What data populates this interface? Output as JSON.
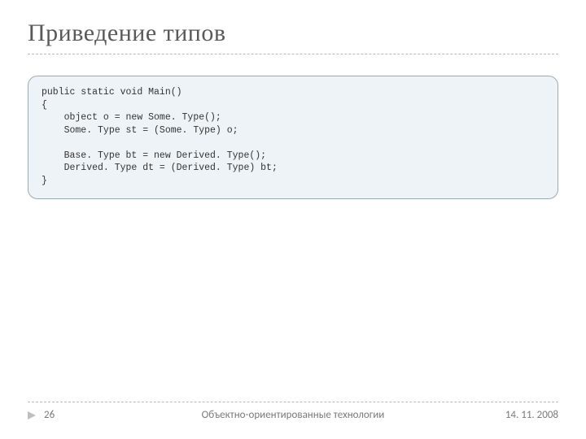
{
  "title": "Приведение типов",
  "code": "public static void Main()\n{\n    object o = new Some. Type();\n    Some. Type st = (Some. Type) o;\n\n    Base. Type bt = new Derived. Type();\n    Derived. Type dt = (Derived. Type) bt;\n}",
  "footer": {
    "page": "26",
    "course": "Объектно-ориентированные технологии",
    "date": "14. 11. 2008"
  }
}
